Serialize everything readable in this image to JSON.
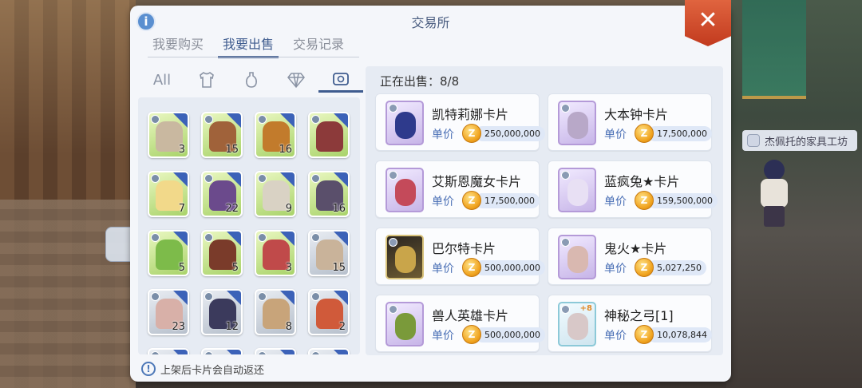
{
  "window": {
    "title": "交易所"
  },
  "tabs": [
    {
      "label": "我要购买",
      "active": false
    },
    {
      "label": "我要出售",
      "active": true
    },
    {
      "label": "交易记录",
      "active": false
    }
  ],
  "filters": [
    {
      "label": "All",
      "icon": "all-text",
      "active": false
    },
    {
      "label": "",
      "icon": "shirt-icon",
      "active": false
    },
    {
      "label": "",
      "icon": "potion-icon",
      "active": false
    },
    {
      "label": "",
      "icon": "gem-icon",
      "active": false
    },
    {
      "label": "",
      "icon": "card-icon",
      "active": true
    }
  ],
  "inventory": {
    "items": [
      {
        "qty": "3",
        "style": "green"
      },
      {
        "qty": "15",
        "style": "green"
      },
      {
        "qty": "16",
        "style": "green"
      },
      {
        "qty": "",
        "style": "green"
      },
      {
        "qty": "7",
        "style": "green"
      },
      {
        "qty": "22",
        "style": "green"
      },
      {
        "qty": "9",
        "style": "green"
      },
      {
        "qty": "16",
        "style": "green"
      },
      {
        "qty": "5",
        "style": "green"
      },
      {
        "qty": "5",
        "style": "green"
      },
      {
        "qty": "3",
        "style": "green"
      },
      {
        "qty": "15",
        "style": "grey"
      },
      {
        "qty": "23",
        "style": "grey"
      },
      {
        "qty": "12",
        "style": "grey"
      },
      {
        "qty": "8",
        "style": "grey"
      },
      {
        "qty": "2",
        "style": "grey"
      },
      {
        "qty": "",
        "style": "grey"
      },
      {
        "qty": "",
        "style": "grey"
      },
      {
        "qty": "",
        "style": "grey"
      },
      {
        "qty": "",
        "style": "grey"
      }
    ]
  },
  "tip": {
    "text": "上架后卡片会自动返还",
    "icon": "exclamation-icon"
  },
  "selling": {
    "header": "正在出售：8/8",
    "price_label": "单价",
    "coin_symbol": "Z",
    "listings": [
      {
        "name": "凯特莉娜卡片",
        "price": "250,000,000",
        "thumb": "purple"
      },
      {
        "name": "大本钟卡片",
        "price": "17,500,000",
        "thumb": "purple"
      },
      {
        "name": "艾斯恩魔女卡片",
        "price": "17,500,000",
        "thumb": "purple"
      },
      {
        "name": "蓝疯兔★卡片",
        "price": "159,500,000",
        "thumb": "purple"
      },
      {
        "name": "巴尔特卡片",
        "price": "500,000,000",
        "thumb": "gold"
      },
      {
        "name": "鬼火★卡片",
        "price": "5,027,250",
        "thumb": "purple"
      },
      {
        "name": "兽人英雄卡片",
        "price": "500,000,000",
        "thumb": "purple"
      },
      {
        "name": "神秘之弓[1]",
        "price": "10,078,844",
        "thumb": "teal",
        "plus": "+8"
      }
    ]
  },
  "npc": {
    "label": "杰佩托的家具工坊"
  },
  "colors": {
    "accent": "#3f5c8f",
    "close": "#d14a2a",
    "coin": "#f0a21d"
  }
}
